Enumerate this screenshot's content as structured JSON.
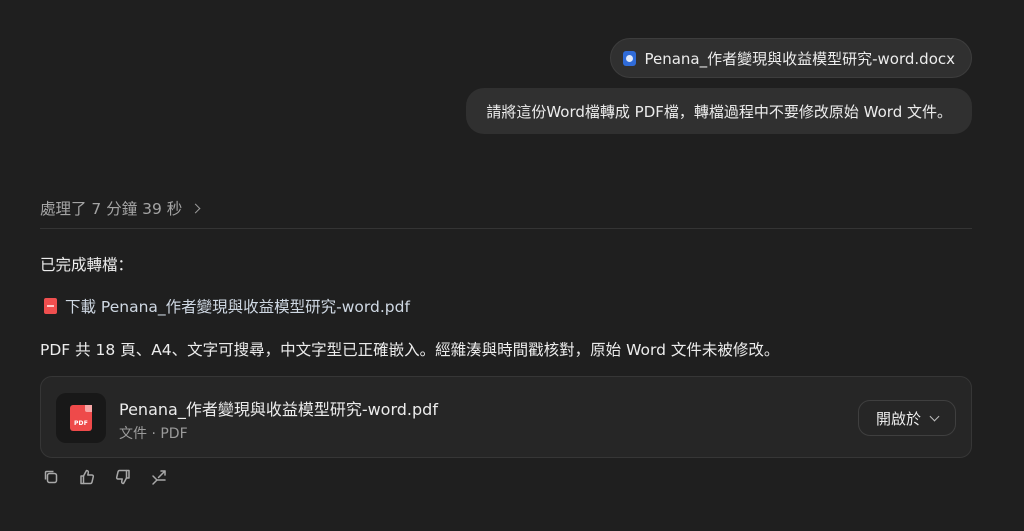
{
  "user": {
    "attachment_name": "Penana_作者變現與收益模型研究-word.docx",
    "attachment_icon": "word-document-icon",
    "message": "請將這份Word檔轉成 PDF檔，轉檔過程中不要修改原始 Word 文件。"
  },
  "assistant": {
    "thinking_label": "處理了 7 分鐘 39 秒",
    "done_text": "已完成轉檔：",
    "download_text": "下載 Penana_作者變現與收益模型研究-word.pdf",
    "summary_text": "PDF 共 18 頁、A4、文字可搜尋，中文字型已正確嵌入。經雜湊與時間戳核對，原始 Word 文件未被修改。",
    "file_card": {
      "icon_text": "PDF",
      "file_name": "Penana_作者變現與收益模型研究-word.pdf",
      "file_meta": "文件 · PDF",
      "open_label": "開啟於"
    },
    "actions": [
      "copy-icon",
      "thumbs-up-icon",
      "thumbs-down-icon",
      "share-icon"
    ]
  },
  "colors": {
    "background": "#1f1f1f",
    "bubble": "#303030",
    "pdf_red": "#ee4a4a",
    "word_blue": "#2f6bd8"
  }
}
